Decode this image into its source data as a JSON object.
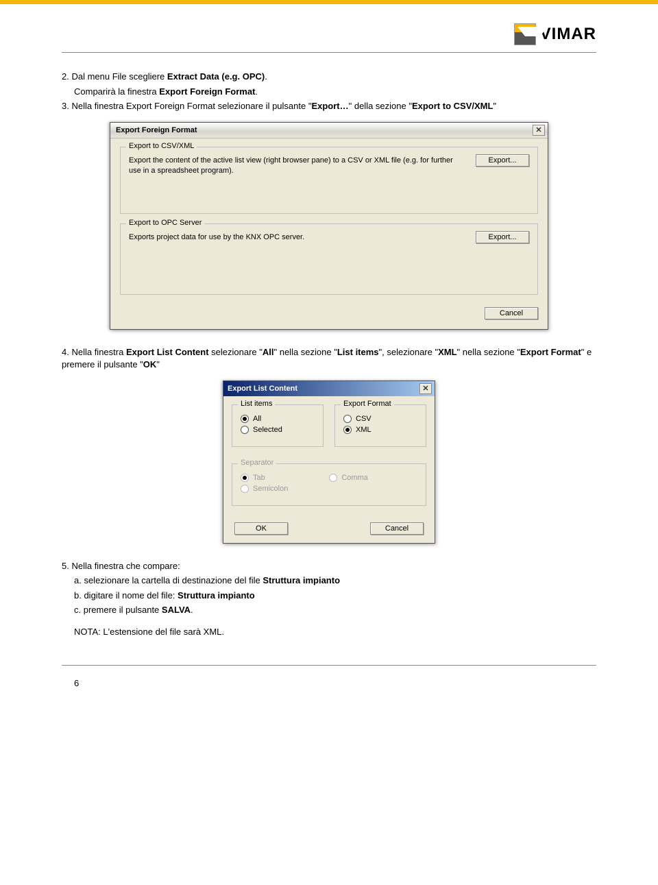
{
  "brand": "VIMAR",
  "instructions": {
    "step2_prefix": "2. Dal menu File scegliere ",
    "step2_bold": "Extract Data (e.g. OPC)",
    "step2_suffix": ".",
    "step2_sub_prefix": "Comparirà la finestra ",
    "step2_sub_bold": "Export Foreign Format",
    "step2_sub_suffix": ".",
    "step3_prefix": "3. Nella finestra Export Foreign Format  selezionare il pulsante \"",
    "step3_bold": "Export…",
    "step3_mid": "\" della sezione \"",
    "step3_bold2": "Export to CSV/XML",
    "step3_suffix": "\"",
    "step4_prefix": "4. Nella finestra ",
    "step4_b1": "Export List Content",
    "step4_mid1": " selezionare \"",
    "step4_b2": "All",
    "step4_mid2": "\" nella sezione \"",
    "step4_b3": "List items",
    "step4_mid3": "\", selezionare \"",
    "step4_b4": "XML",
    "step4_mid4": "\" nella sezione \"",
    "step4_b5": "Export Format",
    "step4_mid5": "\" e premere il pulsante \"",
    "step4_b6": "OK",
    "step4_suffix": "\"",
    "step5": "5. Nella finestra che compare:",
    "step5a_prefix": "a. selezionare la cartella di destinazione del file ",
    "step5a_bold": "Struttura impianto",
    "step5b_prefix": "b. digitare il nome del file: ",
    "step5b_bold": "Struttura impianto",
    "step5c_prefix": "c. premere il pulsante ",
    "step5c_bold": "SALVA",
    "step5c_suffix": ".",
    "note": "NOTA: L'estensione del file sarà XML."
  },
  "dialog1": {
    "title": "Export Foreign Format",
    "group1": {
      "legend": "Export to CSV/XML",
      "text": "Export the content of the active list view (right browser pane) to a CSV or XML file (e.g. for further use in a spreadsheet program).",
      "button": "Export..."
    },
    "group2": {
      "legend": "Export to OPC Server",
      "text": "Exports project data for use by the KNX OPC server.",
      "button": "Export..."
    },
    "cancel": "Cancel"
  },
  "dialog2": {
    "title": "Export List Content",
    "listitems": {
      "legend": "List items",
      "all": "All",
      "selected": "Selected"
    },
    "exportformat": {
      "legend": "Export Format",
      "csv": "CSV",
      "xml": "XML"
    },
    "separator": {
      "legend": "Separator",
      "tab": "Tab",
      "semicolon": "Semicolon",
      "comma": "Comma"
    },
    "ok": "OK",
    "cancel": "Cancel"
  },
  "page_number": "6"
}
